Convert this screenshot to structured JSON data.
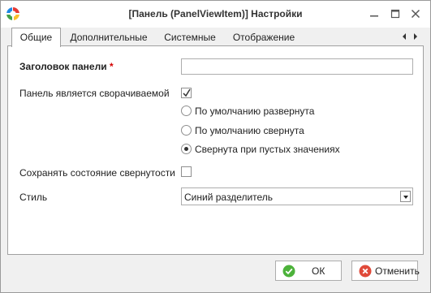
{
  "window": {
    "title": "[Панель (PanelViewItem)] Настройки",
    "icon": "app-logo-icon"
  },
  "tabs": [
    {
      "label": "Общие",
      "active": true
    },
    {
      "label": "Дополнительные",
      "active": false
    },
    {
      "label": "Системные",
      "active": false
    },
    {
      "label": "Отображение",
      "active": false
    }
  ],
  "form": {
    "header_label": "Заголовок панели",
    "required_mark": "*",
    "header_value": "",
    "collapsible_label": "Панель является сворачиваемой",
    "collapsible_checked": true,
    "radio_options": [
      {
        "label": "По умолчанию развернута",
        "checked": false
      },
      {
        "label": "По умолчанию свернута",
        "checked": false
      },
      {
        "label": "Свернута при пустых значениях",
        "checked": true
      }
    ],
    "save_state_label": "Сохранять состояние свернутости",
    "save_state_checked": false,
    "style_label": "Стиль",
    "style_value": "Синий разделитель"
  },
  "buttons": {
    "ok_label": "ОК",
    "cancel_label": "Отменить"
  },
  "colors": {
    "ok_icon": "#4cb23a",
    "cancel_icon": "#e04a3a",
    "required": "#d40000"
  }
}
